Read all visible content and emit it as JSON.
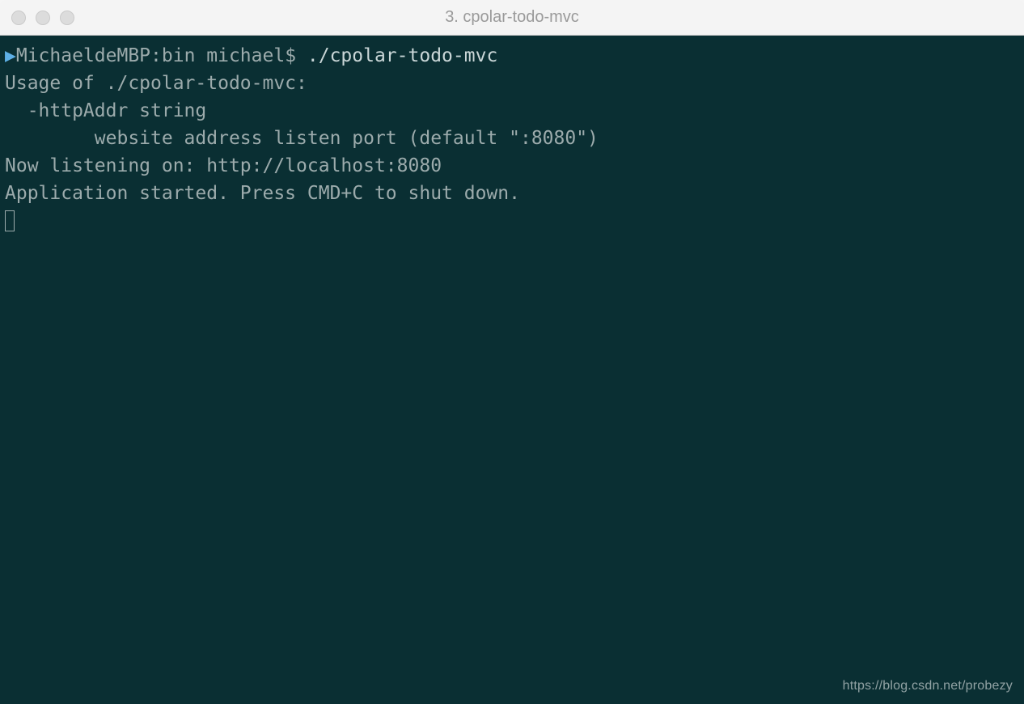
{
  "window": {
    "title": "3. cpolar-todo-mvc"
  },
  "terminal": {
    "prompt_arrow": "▶",
    "prompt": "MichaeldeMBP:bin michael$ ",
    "command": "./cpolar-todo-mvc",
    "output": {
      "line1": "Usage of ./cpolar-todo-mvc:",
      "line2": "  -httpAddr string",
      "line3": "        website address listen port (default \":8080\")",
      "line4": "Now listening on: http://localhost:8080",
      "line5": "Application started. Press CMD+C to shut down."
    }
  },
  "watermark": "https://blog.csdn.net/probezy"
}
